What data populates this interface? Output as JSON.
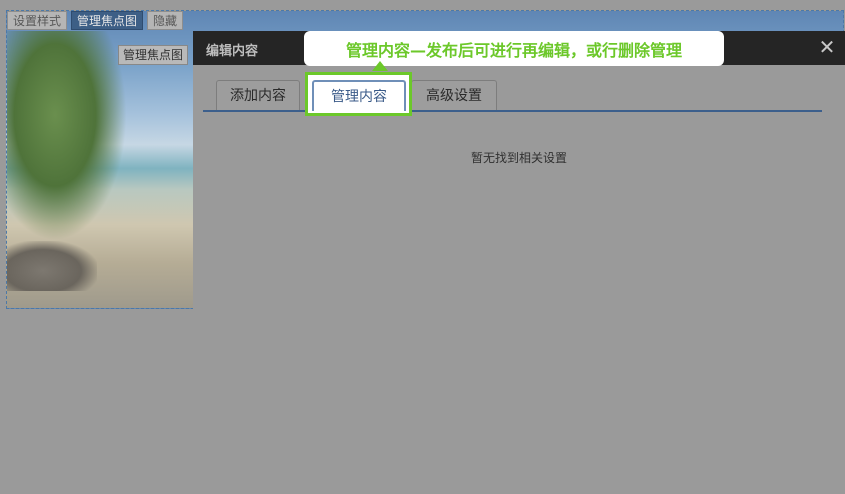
{
  "focus_toolbar": {
    "buttons": [
      "设置样式",
      "管理焦点图",
      "隐藏"
    ],
    "image_label": "管理焦点图"
  },
  "dialog": {
    "title": "编辑内容",
    "close_symbol": "✕",
    "tabs": [
      "添加内容",
      "管理内容",
      "高级设置"
    ],
    "active_tab": "管理内容",
    "empty_message": "暂无找到相关设置"
  },
  "tooltip": {
    "text": "管理内容—发布后可进行再编辑，或行删除管理"
  },
  "colors": {
    "overlay": "#9a9a9a",
    "tooltip_text": "#6cc82a",
    "tab_line": "#3c5f8c"
  }
}
